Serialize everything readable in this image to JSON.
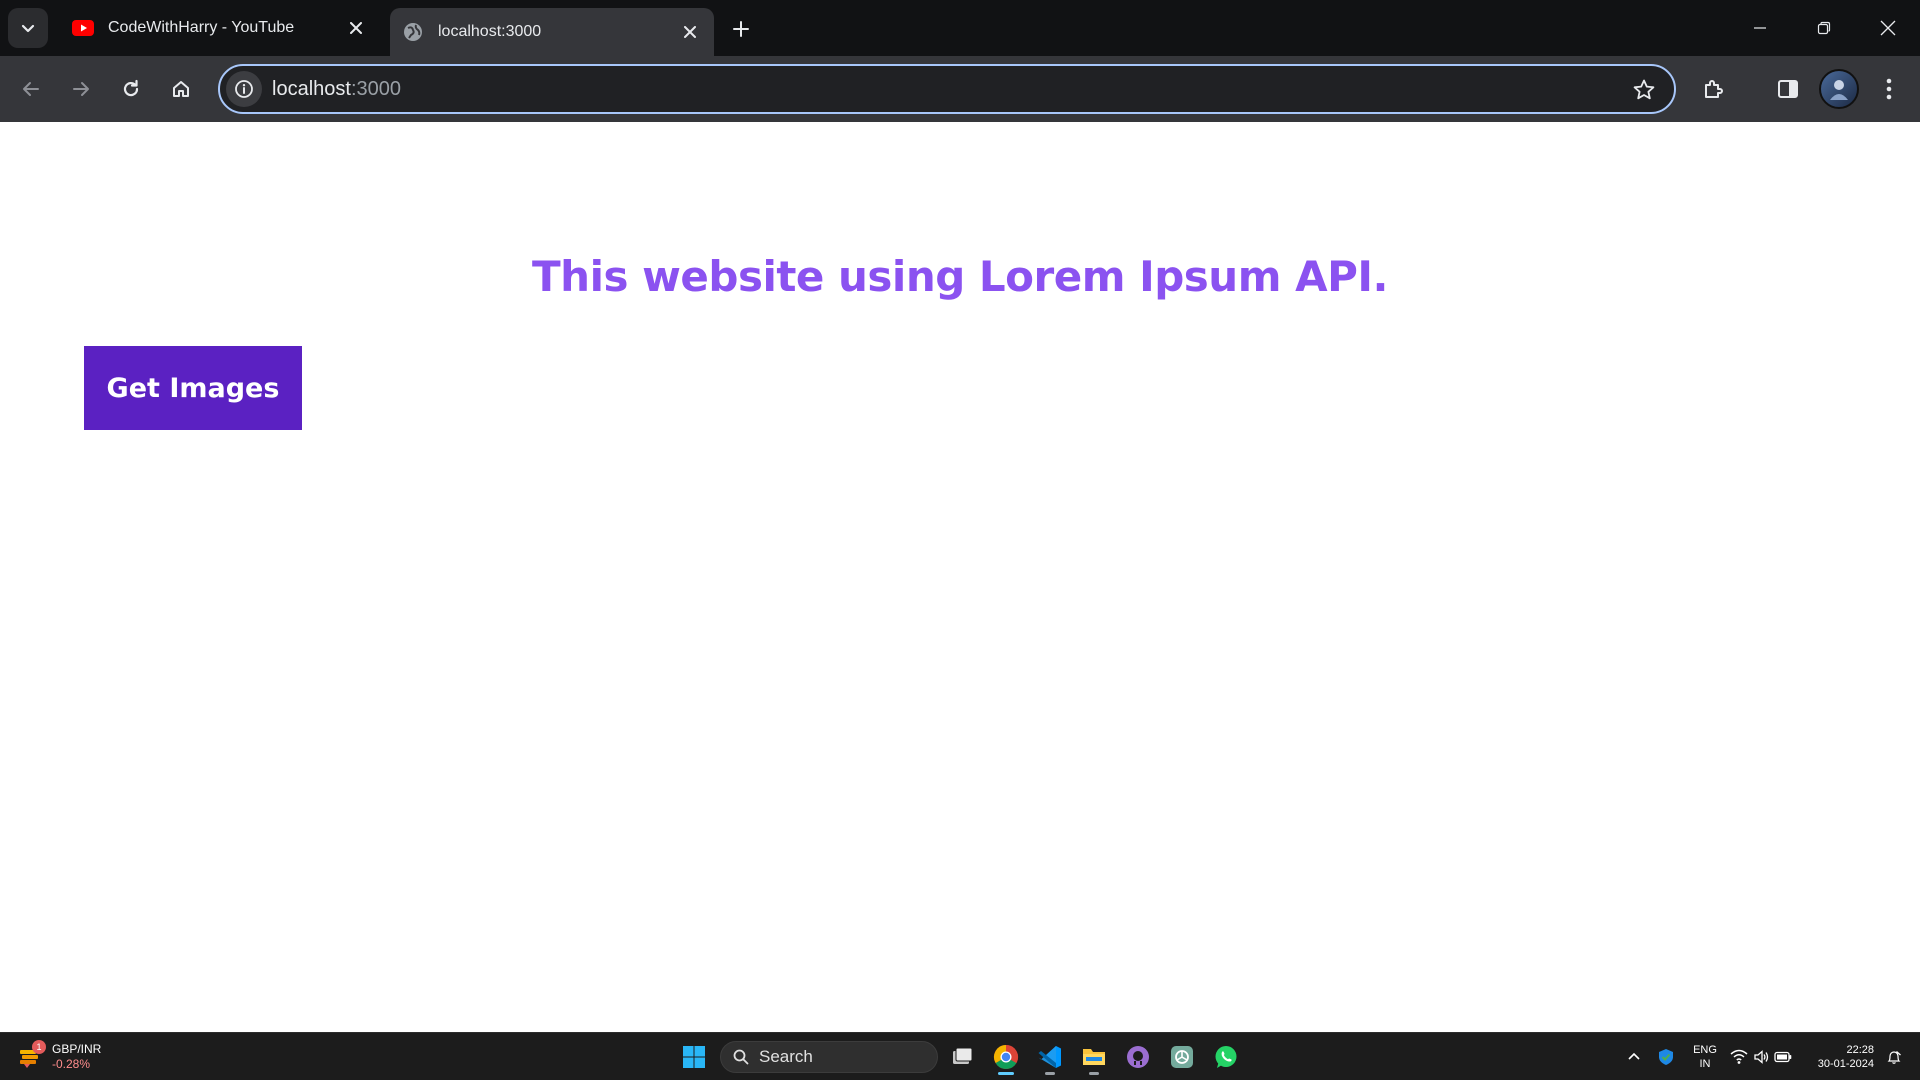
{
  "browser": {
    "tabs": [
      {
        "title": "CodeWithHarry - YouTube",
        "favicon": "youtube-icon",
        "active": false
      },
      {
        "title": "localhost:3000",
        "favicon": "globe-icon",
        "active": true
      }
    ],
    "address": {
      "host": "localhost",
      "port": ":3000"
    }
  },
  "page": {
    "heading": "This website using Lorem Ipsum API.",
    "button_label": "Get Images",
    "heading_color": "#8b52f0",
    "button_color": "#5b21c2"
  },
  "taskbar": {
    "widget": {
      "title": "GBP/INR",
      "change": "-0.28%",
      "badge": "1"
    },
    "search_label": "Search",
    "language": {
      "line1": "ENG",
      "line2": "IN"
    },
    "clock": {
      "time": "22:28",
      "date": "30-01-2024"
    }
  }
}
